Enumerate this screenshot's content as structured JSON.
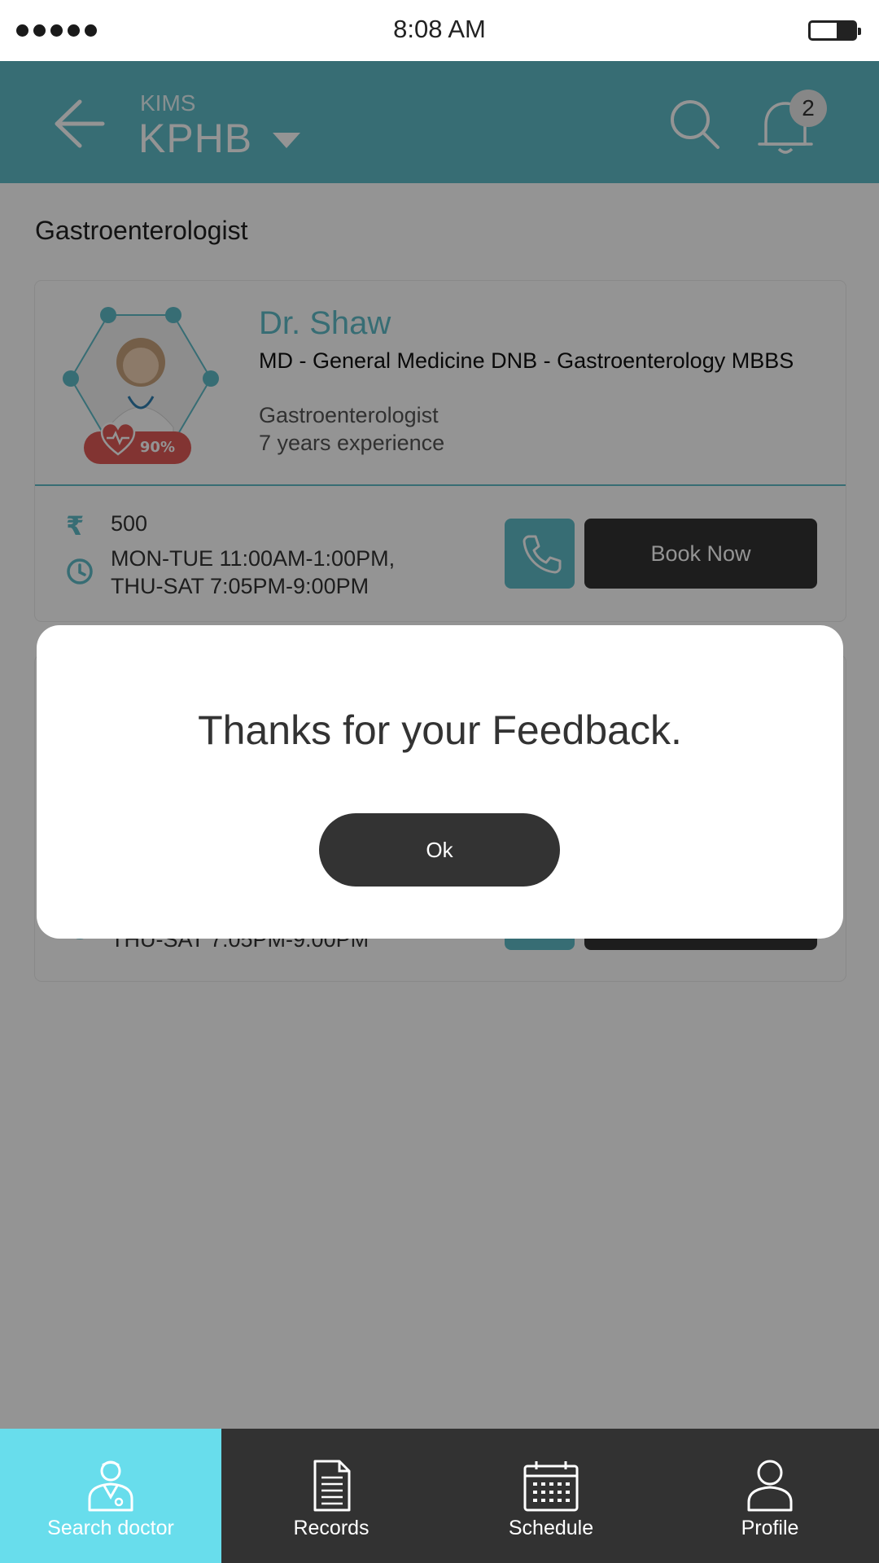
{
  "status_bar": {
    "time": "8:08 AM"
  },
  "header": {
    "hospital": "KIMS",
    "location": "KPHB",
    "notification_count": "2"
  },
  "section_title": "Gastroenterologist",
  "doctor": {
    "name": "Dr. Shaw",
    "degrees": "MD - General Medicine DNB - Gastroenterology MBBS",
    "specialty": "Gastroenterologist",
    "experience": "7 years experience",
    "rating": "90%",
    "fee_symbol": "₹",
    "fee": "500",
    "timings_line1": "MON-TUE 11:00AM-1:00PM,",
    "timings_line2": "THU-SAT 7:05PM-9:00PM",
    "book_label": "Book Now"
  },
  "doctor2": {
    "timings_line2": "THU-SAT 7:05PM-9:00PM"
  },
  "dialog": {
    "message": "Thanks for your Feedback.",
    "ok_label": "Ok"
  },
  "tabs": [
    {
      "label": "Search doctor",
      "icon": "doctor-icon",
      "active": true
    },
    {
      "label": "Records",
      "icon": "document-icon",
      "active": false
    },
    {
      "label": "Schedule",
      "icon": "calendar-icon",
      "active": false
    },
    {
      "label": "Profile",
      "icon": "user-icon",
      "active": false
    }
  ],
  "colors": {
    "accent": "#5fbcc9",
    "tab_active": "#68ddec",
    "dark": "#333333",
    "rating": "#e05b57"
  }
}
